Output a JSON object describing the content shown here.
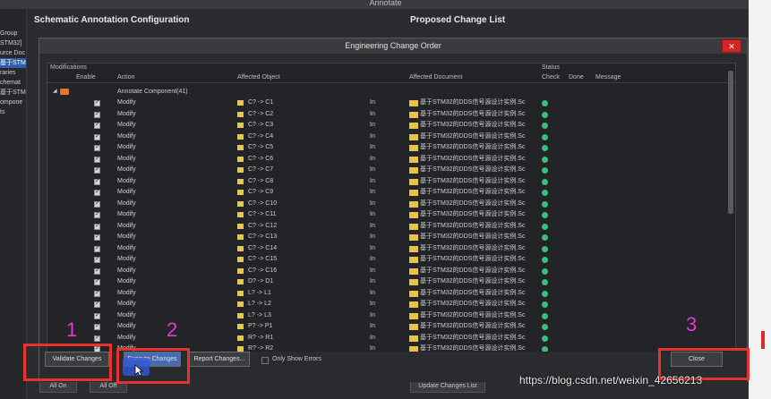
{
  "annotate_window": {
    "title": "Annotate",
    "left_panel": [
      "Group",
      "STM32]",
      "urce Doc",
      "基于STM",
      "raries",
      "chemat",
      "基于STM",
      "ompone",
      "ts"
    ],
    "schematic_heading": "Schematic Annotation Configuration",
    "proposed_heading": "Proposed Change List",
    "bottom_buttons": [
      "All On",
      "All Off",
      "Update Changes List"
    ]
  },
  "eco": {
    "title": "Engineering Change Order",
    "close_x": "✕",
    "headers": {
      "modifications": "Modifications",
      "status": "Status",
      "enable": "Enable",
      "action": "Action",
      "affected_object": "Affected Object",
      "affected_document": "Affected Document",
      "check": "Check",
      "done": "Done",
      "message": "Message"
    },
    "group": {
      "label": "Annotate Component(41)",
      "expander": "◢"
    },
    "rows": [
      {
        "action": "Modify",
        "object": "C? -> C1",
        "in": "In",
        "doc": "基于STM32的DDS信号源设计实例.Sc"
      },
      {
        "action": "Modify",
        "object": "C? -> C2",
        "in": "In",
        "doc": "基于STM32的DDS信号源设计实例.Sc"
      },
      {
        "action": "Modify",
        "object": "C? -> C3",
        "in": "In",
        "doc": "基于STM32的DDS信号源设计实例.Sc"
      },
      {
        "action": "Modify",
        "object": "C? -> C4",
        "in": "In",
        "doc": "基于STM32的DDS信号源设计实例.Sc"
      },
      {
        "action": "Modify",
        "object": "C? -> C5",
        "in": "In",
        "doc": "基于STM32的DDS信号源设计实例.Sc"
      },
      {
        "action": "Modify",
        "object": "C? -> C6",
        "in": "In",
        "doc": "基于STM32的DDS信号源设计实例.Sc"
      },
      {
        "action": "Modify",
        "object": "C? -> C7",
        "in": "In",
        "doc": "基于STM32的DDS信号源设计实例.Sc"
      },
      {
        "action": "Modify",
        "object": "C? -> C8",
        "in": "In",
        "doc": "基于STM32的DDS信号源设计实例.Sc"
      },
      {
        "action": "Modify",
        "object": "C? -> C9",
        "in": "In",
        "doc": "基于STM32的DDS信号源设计实例.Sc"
      },
      {
        "action": "Modify",
        "object": "C? -> C10",
        "in": "In",
        "doc": "基于STM32的DDS信号源设计实例.Sc"
      },
      {
        "action": "Modify",
        "object": "C? -> C11",
        "in": "In",
        "doc": "基于STM32的DDS信号源设计实例.Sc"
      },
      {
        "action": "Modify",
        "object": "C? -> C12",
        "in": "In",
        "doc": "基于STM32的DDS信号源设计实例.Sc"
      },
      {
        "action": "Modify",
        "object": "C? -> C13",
        "in": "In",
        "doc": "基于STM32的DDS信号源设计实例.Sc"
      },
      {
        "action": "Modify",
        "object": "C? -> C14",
        "in": "In",
        "doc": "基于STM32的DDS信号源设计实例.Sc"
      },
      {
        "action": "Modify",
        "object": "C? -> C15",
        "in": "In",
        "doc": "基于STM32的DDS信号源设计实例.Sc"
      },
      {
        "action": "Modify",
        "object": "C? -> C16",
        "in": "In",
        "doc": "基于STM32的DDS信号源设计实例.Sc"
      },
      {
        "action": "Modify",
        "object": "D? -> D1",
        "in": "In",
        "doc": "基于STM32的DDS信号源设计实例.Sc"
      },
      {
        "action": "Modify",
        "object": "L? -> L1",
        "in": "In",
        "doc": "基于STM32的DDS信号源设计实例.Sc"
      },
      {
        "action": "Modify",
        "object": "L? -> L2",
        "in": "In",
        "doc": "基于STM32的DDS信号源设计实例.Sc"
      },
      {
        "action": "Modify",
        "object": "L? -> L3",
        "in": "In",
        "doc": "基于STM32的DDS信号源设计实例.Sc"
      },
      {
        "action": "Modify",
        "object": "P? -> P1",
        "in": "In",
        "doc": "基于STM32的DDS信号源设计实例.Sc"
      },
      {
        "action": "Modify",
        "object": "R? -> R1",
        "in": "In",
        "doc": "基于STM32的DDS信号源设计实例.Sc"
      },
      {
        "action": "Modify",
        "object": "R? -> R2",
        "in": "In",
        "doc": "基于STM32的DDS信号源设计实例.Sc"
      }
    ],
    "buttons": {
      "validate": "Validate Changes",
      "execute": "Execute Changes",
      "report": "Report Changes...",
      "only_errors": "Only Show Errors",
      "close": "Close"
    }
  },
  "markers": [
    "1",
    "2",
    "3"
  ],
  "watermark": "https://blog.csdn.net/weixin_42656213",
  "colors": {
    "highlight_red": "#e8322f",
    "marker_magenta": "#e23ad6",
    "ok_green": "#39c07a"
  }
}
